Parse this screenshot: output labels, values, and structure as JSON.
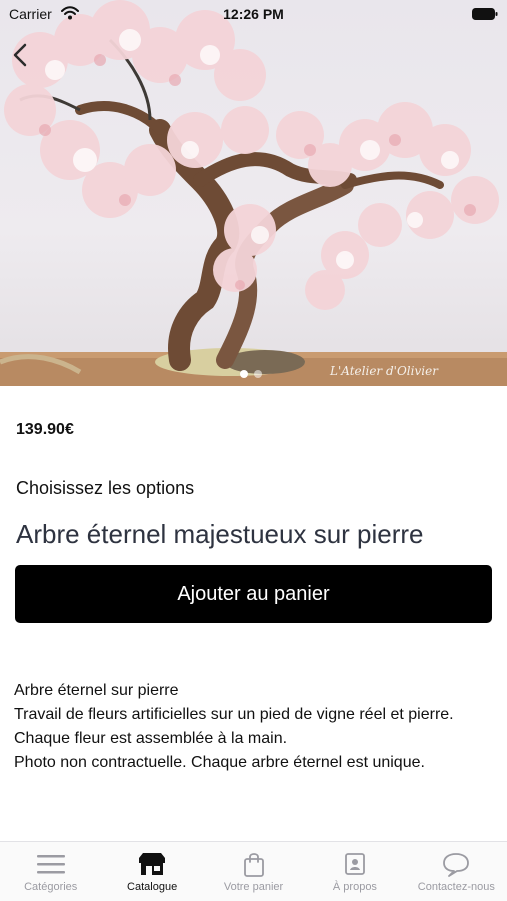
{
  "status_bar": {
    "carrier": "Carrier",
    "time": "12:26 PM"
  },
  "hero": {
    "watermark": "L'Atelier d'Olivier",
    "pager_active": 1,
    "pager_count": 2
  },
  "product": {
    "price": "139.90€",
    "options_heading": "Choisissez les options",
    "title": "Arbre éternel majestueux sur pierre",
    "add_to_cart_label": "Ajouter au panier",
    "description": [
      "Arbre éternel sur pierre",
      "Travail de fleurs artificielles sur un pied de vigne réel et pierre.",
      "Chaque fleur est assemblée à la main.",
      "Photo non contractuelle. Chaque arbre éternel est unique."
    ]
  },
  "tabbar": {
    "active_tab": "catalogue",
    "tabs": [
      {
        "id": "categories",
        "label": "Catégories",
        "icon": "menu-icon"
      },
      {
        "id": "catalogue",
        "label": "Catalogue",
        "icon": "store-icon"
      },
      {
        "id": "cart",
        "label": "Votre panier",
        "icon": "shopping-bag-icon"
      },
      {
        "id": "about",
        "label": "À propos",
        "icon": "contact-card-icon"
      },
      {
        "id": "contact",
        "label": "Contactez-nous",
        "icon": "chat-bubble-icon"
      }
    ]
  },
  "colors": {
    "button_background": "#000000",
    "button_text": "#ffffff",
    "title_text": "#2e3340",
    "tab_inactive": "#9b9ba2",
    "tab_active": "#111111"
  }
}
